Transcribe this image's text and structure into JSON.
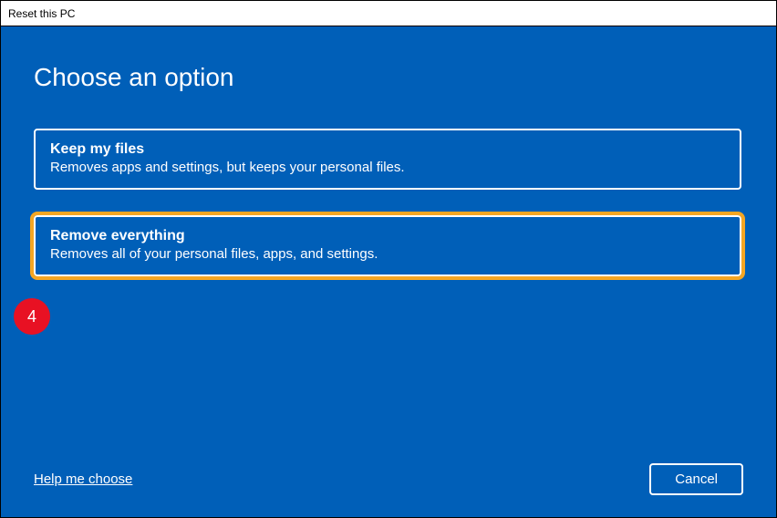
{
  "window": {
    "title": "Reset this PC"
  },
  "page": {
    "title": "Choose an option"
  },
  "options": {
    "keep": {
      "title": "Keep my files",
      "desc": "Removes apps and settings, but keeps your personal files."
    },
    "remove": {
      "title": "Remove everything",
      "desc": "Removes all of your personal files, apps, and settings."
    }
  },
  "annotation": {
    "step_number": "4"
  },
  "footer": {
    "help_link": "Help me choose",
    "cancel_label": "Cancel"
  }
}
